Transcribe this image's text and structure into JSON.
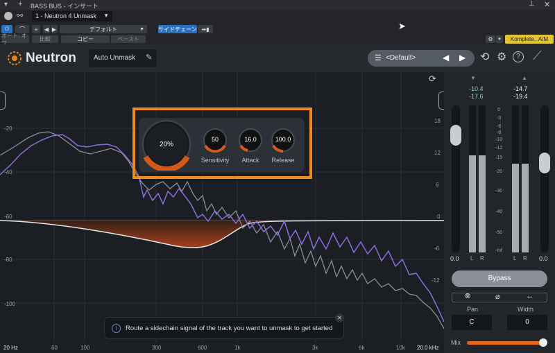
{
  "host": {
    "track_title": "BASS BUS - インサート",
    "preset_slot": "1 - Neutron 4 Unmask",
    "auto_off": "オート: オフ",
    "compare": "比較",
    "preset_default": "デフォルト",
    "copy": "コピー",
    "paste": "ペースト",
    "sidechain": "サイドチェーン",
    "komplete": "Komplete.. A/M"
  },
  "plugin": {
    "logo": "Neutron",
    "module_name": "Auto Unmask",
    "preset": "<Default>"
  },
  "controls": {
    "amount": "20%",
    "sensitivity_value": "50",
    "sensitivity_label": "Sensitivity",
    "attack_value": "16.0",
    "attack_label": "Attack",
    "release_value": "100.0",
    "release_label": "Release"
  },
  "axes": {
    "left_db": [
      "-20",
      "-40",
      "-60",
      "-80",
      "-100"
    ],
    "right_db": [
      "18",
      "12",
      "6",
      "0",
      "-6",
      "-12"
    ],
    "freq": [
      "20 Hz",
      "60",
      "100",
      "300",
      "600",
      "1k",
      "3k",
      "6k",
      "10k",
      "20.0 kHz"
    ]
  },
  "notice": {
    "text": "Route a sidechain signal of the track you want to unmask to get started"
  },
  "meters": {
    "in_peak": "-10.4",
    "in_rms": "-17.6",
    "out_peak": "-14.7",
    "out_rms": "-19.4",
    "scale": [
      "0",
      "-3",
      "-6",
      "-8",
      "-10",
      "-12",
      "-15",
      "-20",
      "-30",
      "-40",
      "-50",
      "-Inf"
    ],
    "in_val": "0.0",
    "out_val": "0.0",
    "l": "L",
    "r": "R",
    "bypass": "Bypass",
    "pan_label": "Pan",
    "pan_value": "C",
    "width_label": "Width",
    "width_value": "0",
    "mix_label": "Mix",
    "mix_level": 0.97
  },
  "colors": {
    "accent": "#e8861a",
    "purple": "#8a6ee0",
    "knob_orange": "#d2591c",
    "meter_green": "#7fd6b0"
  }
}
